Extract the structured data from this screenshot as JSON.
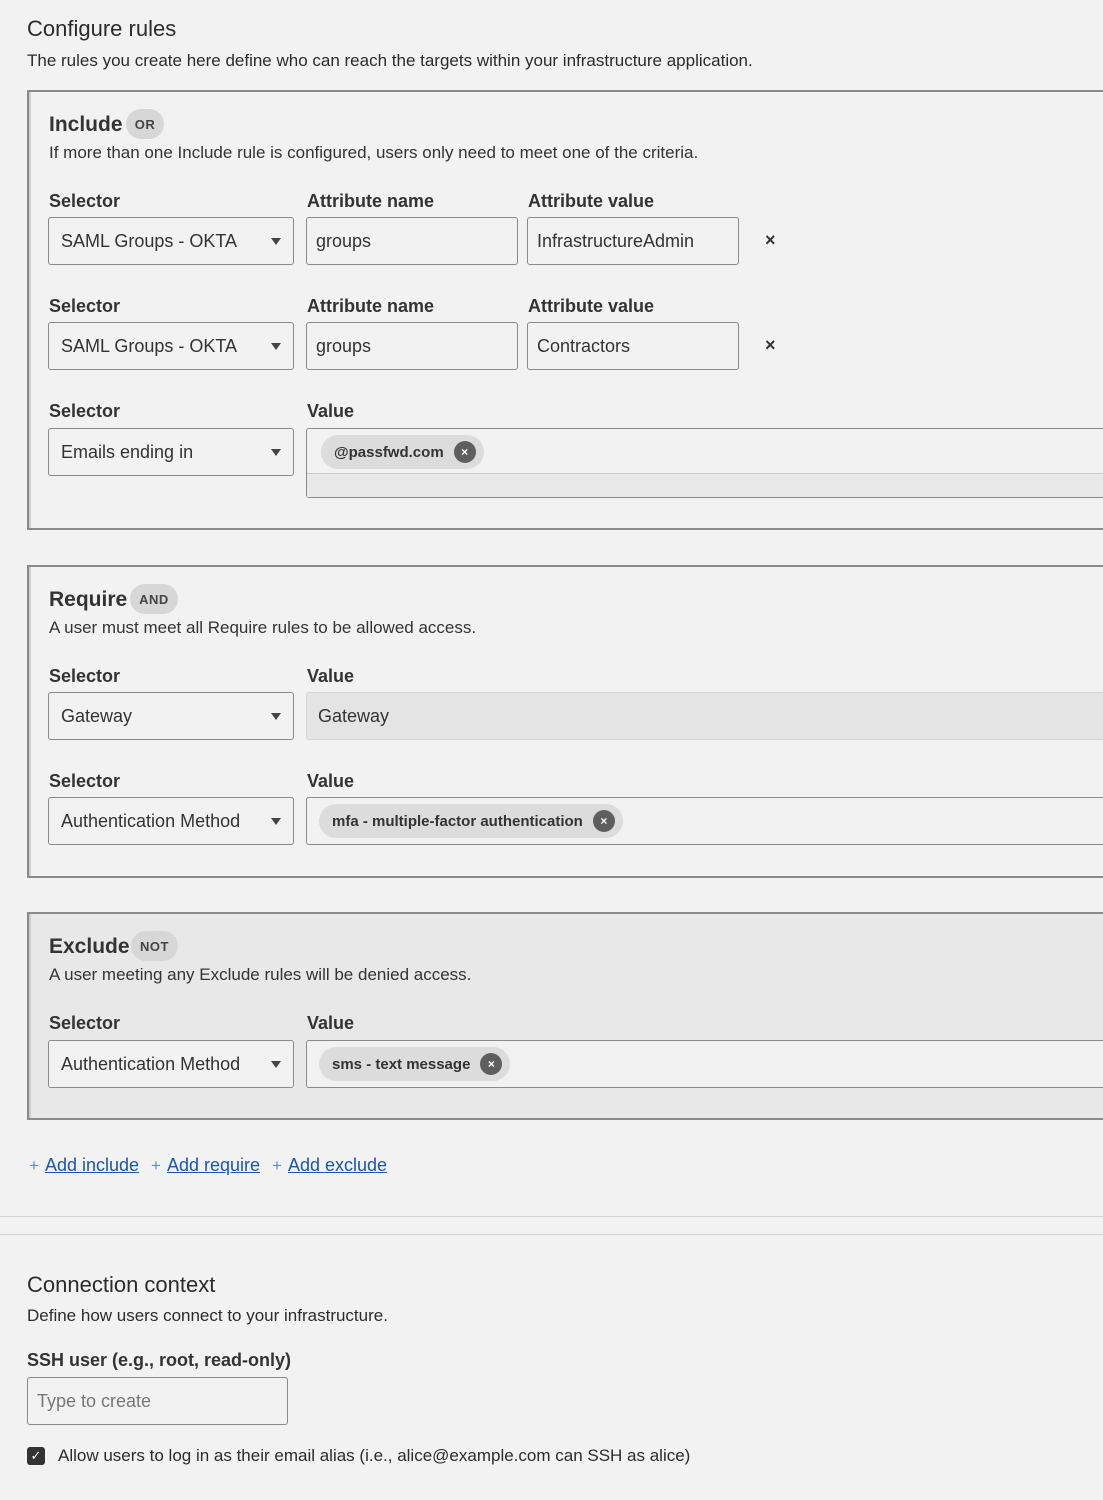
{
  "configure": {
    "title": "Configure rules",
    "description": "The rules you create here define who can reach the targets within your infrastructure application."
  },
  "include": {
    "title": "Include",
    "badge": "OR",
    "description": "If more than one Include rule is configured, users only need to meet one of the criteria.",
    "rows": [
      {
        "selector_label": "Selector",
        "selector_value": "SAML Groups - OKTA",
        "attr_name_label": "Attribute name",
        "attr_name_value": "groups",
        "attr_value_label": "Attribute value",
        "attr_value_value": "InfrastructureAdmin"
      },
      {
        "selector_label": "Selector",
        "selector_value": "SAML Groups - OKTA",
        "attr_name_label": "Attribute name",
        "attr_name_value": "groups",
        "attr_value_label": "Attribute value",
        "attr_value_value": "Contractors"
      },
      {
        "selector_label": "Selector",
        "selector_value": "Emails ending in",
        "value_label": "Value",
        "tags": [
          "@passfwd.com"
        ]
      }
    ]
  },
  "require": {
    "title": "Require",
    "badge": "AND",
    "description": "A user must meet all Require rules to be allowed access.",
    "rows": [
      {
        "selector_label": "Selector",
        "selector_value": "Gateway",
        "value_label": "Value",
        "value": "Gateway"
      },
      {
        "selector_label": "Selector",
        "selector_value": "Authentication Method",
        "value_label": "Value",
        "tags": [
          "mfa - multiple-factor authentication"
        ]
      }
    ]
  },
  "exclude": {
    "title": "Exclude",
    "badge": "NOT",
    "description": "A user meeting any Exclude rules will be denied access.",
    "rows": [
      {
        "selector_label": "Selector",
        "selector_value": "Authentication Method",
        "value_label": "Value",
        "tags": [
          "sms - text message"
        ]
      }
    ]
  },
  "actions": {
    "add_include": "Add include",
    "add_require": "Add require",
    "add_exclude": "Add exclude"
  },
  "connection": {
    "title": "Connection context",
    "description": "Define how users connect to your infrastructure.",
    "ssh_label": "SSH user (e.g., root, read-only)",
    "ssh_placeholder": "Type to create",
    "alias_checked": true,
    "alias_label": "Allow users to log in as their email alias (i.e., alice@example.com can SSH as alice)"
  },
  "icons": {
    "remove": "×",
    "plus": "+",
    "check": "✓"
  }
}
